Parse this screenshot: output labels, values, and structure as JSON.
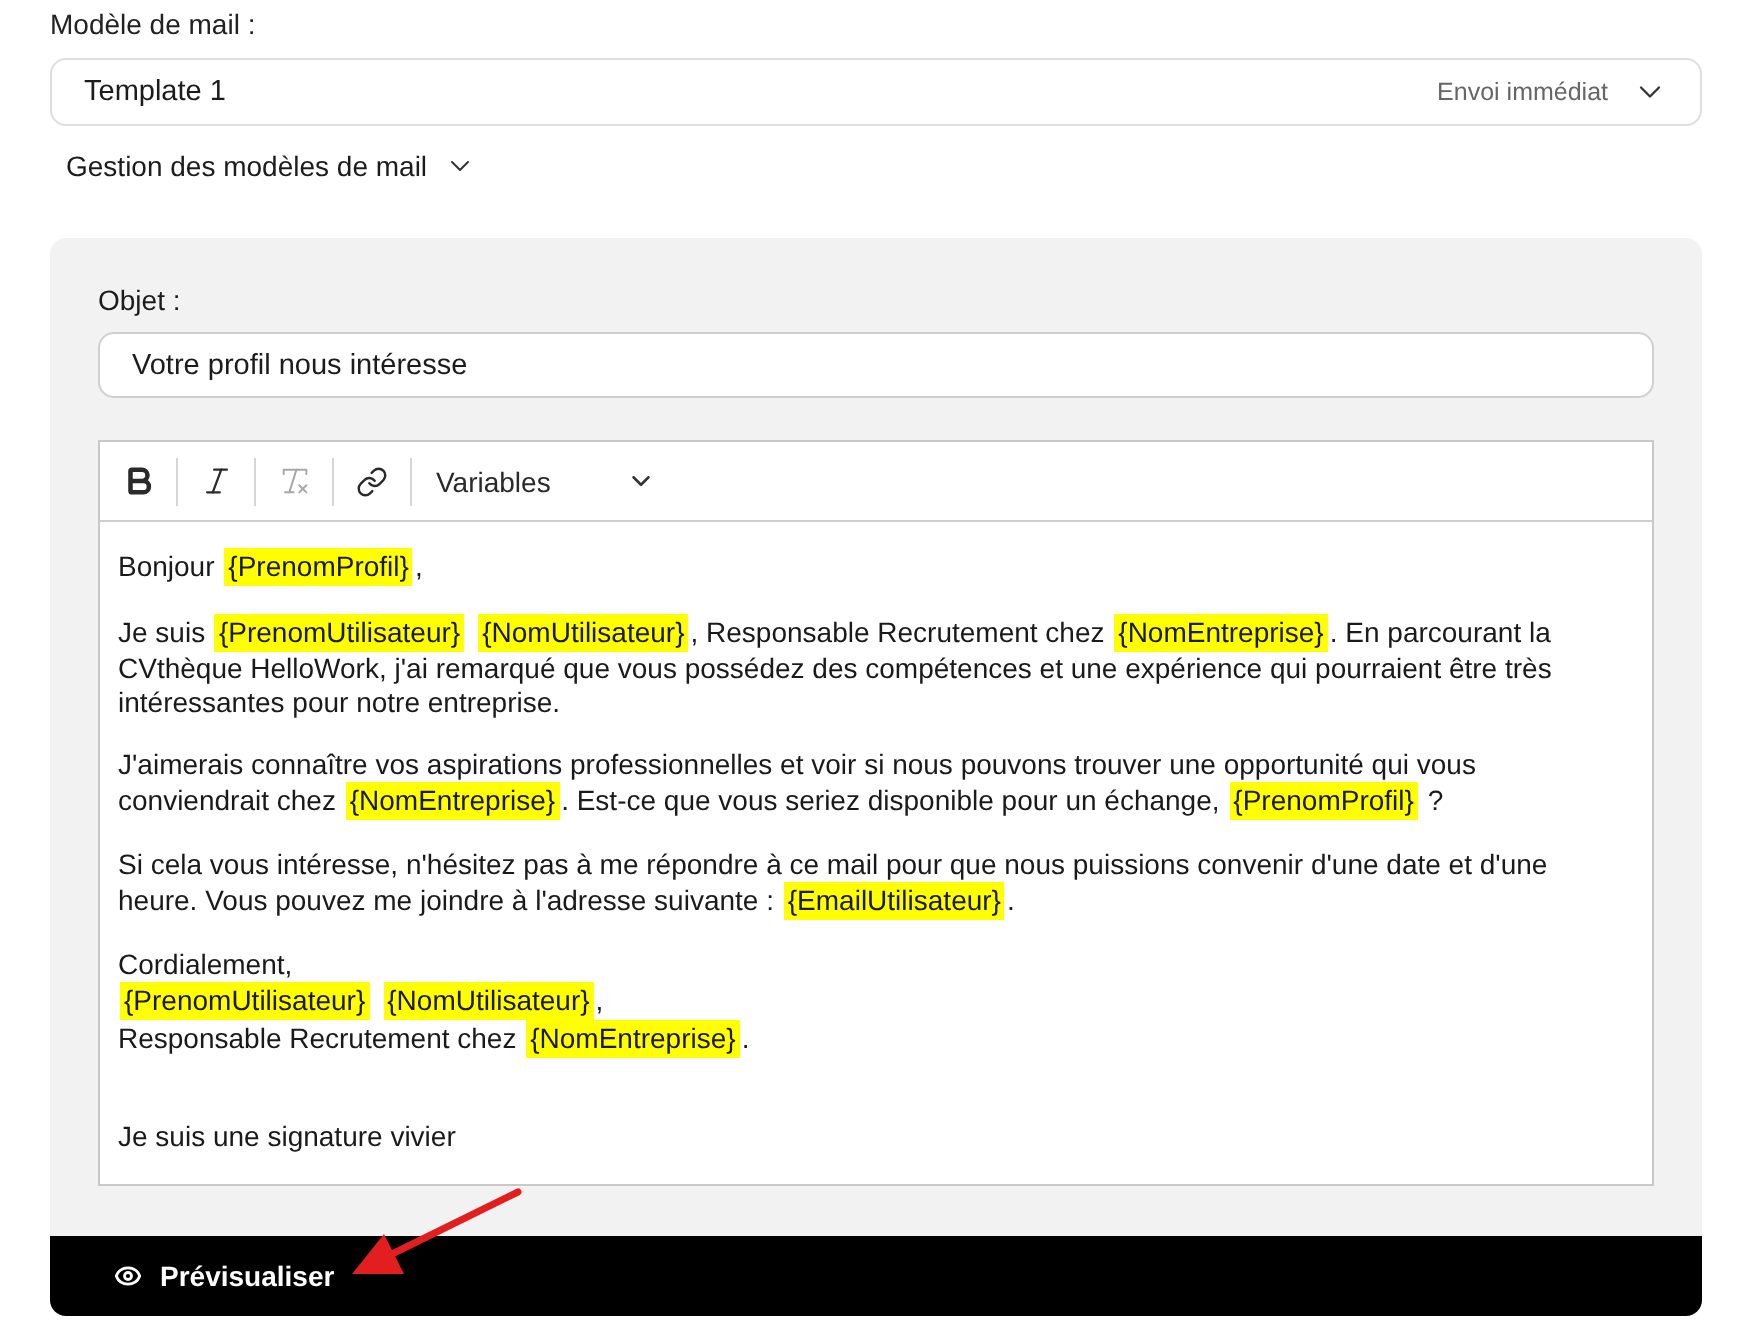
{
  "template_field": {
    "label": "Modèle de mail :",
    "value": "Template 1",
    "send_mode": "Envoi immédiat"
  },
  "manage_templates": {
    "label": "Gestion des modèles de mail",
    "expanded": false
  },
  "subject": {
    "label": "Objet :",
    "value": "Votre profil nous intéresse"
  },
  "editor": {
    "toolbar": [
      {
        "kind": "bold",
        "disabled": false
      },
      {
        "kind": "italic",
        "disabled": false
      },
      {
        "kind": "clear-format",
        "disabled": true
      },
      {
        "kind": "link",
        "disabled": false
      }
    ],
    "variables_menu": {
      "label": "Variables"
    },
    "paragraphs": [
      {
        "kind": "body",
        "lines": [
          [
            {
              "kind": "text",
              "text": "Bonjour "
            },
            {
              "kind": "variable",
              "text": "{PrenomProfil}"
            },
            {
              "kind": "text",
              "text": ","
            }
          ]
        ]
      },
      {
        "kind": "body",
        "lines": [
          [
            {
              "kind": "text",
              "text": "Je suis "
            },
            {
              "kind": "variable",
              "text": "{PrenomUtilisateur}"
            },
            {
              "kind": "variable",
              "text": "{NomUtilisateur}"
            },
            {
              "kind": "text",
              "text": ", Responsable Recrutement chez "
            },
            {
              "kind": "variable",
              "text": "{NomEntreprise}"
            },
            {
              "kind": "text",
              "text": ". En parcourant la CVthèque HelloWork, j'ai remarqué que vous possédez des compétences et une expérience qui pourraient être très intéressantes pour notre entreprise."
            }
          ]
        ]
      },
      {
        "kind": "body",
        "lines": [
          [
            {
              "kind": "text",
              "text": "J'aimerais connaître vos aspirations professionnelles et voir si nous pouvons trouver une opportunité qui vous conviendrait chez "
            },
            {
              "kind": "variable",
              "text": "{NomEntreprise}"
            },
            {
              "kind": "text",
              "text": ". Est-ce que vous seriez disponible pour un échange, "
            },
            {
              "kind": "variable",
              "text": "{PrenomProfil}"
            },
            {
              "kind": "text",
              "text": " ?"
            }
          ]
        ]
      },
      {
        "kind": "body",
        "lines": [
          [
            {
              "kind": "text",
              "text": "Si cela vous intéresse, n'hésitez pas à me répondre à ce mail pour que nous puissions convenir d'une date et d'une heure. Vous pouvez me joindre à l'adresse suivante : "
            },
            {
              "kind": "variable",
              "text": "{EmailUtilisateur}"
            },
            {
              "kind": "text",
              "text": "."
            }
          ]
        ]
      },
      {
        "kind": "body",
        "lines": [
          [
            {
              "kind": "text",
              "text": "Cordialement,"
            }
          ],
          [
            {
              "kind": "variable",
              "text": "{PrenomUtilisateur}"
            },
            {
              "kind": "variable",
              "text": "{NomUtilisateur}"
            },
            {
              "kind": "text",
              "text": ","
            }
          ],
          [
            {
              "kind": "text",
              "text": "Responsable Recrutement chez "
            },
            {
              "kind": "variable",
              "text": "{NomEntreprise}"
            },
            {
              "kind": "text",
              "text": "."
            }
          ]
        ]
      },
      {
        "kind": "signature",
        "lines": [
          [
            {
              "kind": "text",
              "text": "Je suis une signature vivier"
            }
          ]
        ]
      }
    ]
  },
  "footer": {
    "preview_button": {
      "label": "Prévisualiser"
    }
  }
}
